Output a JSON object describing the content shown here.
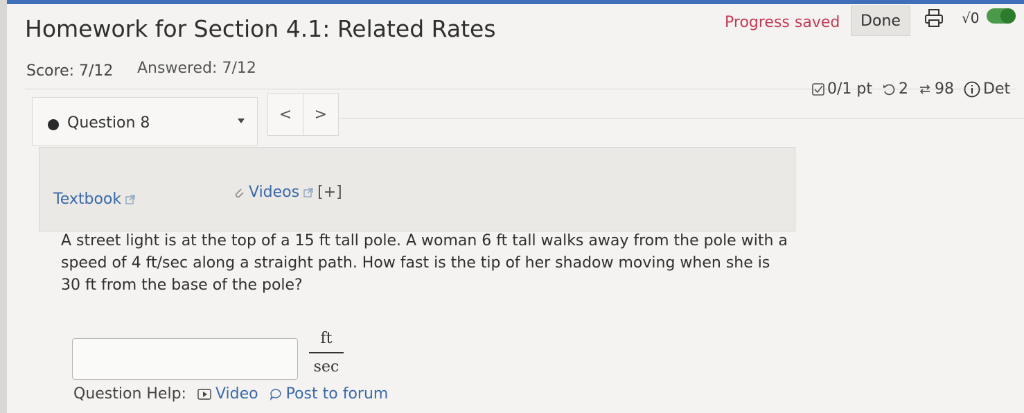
{
  "header": {
    "title": "Homework for Section 4.1: Related Rates",
    "progress_status": "Progress saved",
    "done_label": "Done",
    "sqrt_label": "√0",
    "icons": [
      "print-icon",
      "sqrt-icon",
      "toggle-switch"
    ]
  },
  "scores": {
    "score": "Score: 7/12",
    "answered": "Answered: 7/12"
  },
  "question_nav": {
    "selected": "Question 8",
    "prev_label": "<",
    "next_label": ">"
  },
  "points": {
    "pts": "0/1 pt",
    "retries": "2",
    "submissions": "98",
    "details": "Det"
  },
  "resources": {
    "textbook": "Textbook",
    "videos": "Videos",
    "expand": "[+]"
  },
  "question": {
    "text": "A street light is at the top of a 15 ft tall pole. A woman 6 ft tall walks away from the pole with a speed of 4 ft/sec along a straight path. How fast is the tip of her shadow moving when she is 30 ft from the base of the pole?",
    "answer_value": "",
    "unit_numerator": "ft",
    "unit_denominator": "sec"
  },
  "help": {
    "label": "Question Help:",
    "video": "Video",
    "forum": "Post to forum"
  },
  "colors": {
    "accent_red": "#c33a55",
    "link_blue": "#3a6aa8",
    "toggle_green": "#4a9a4a"
  }
}
